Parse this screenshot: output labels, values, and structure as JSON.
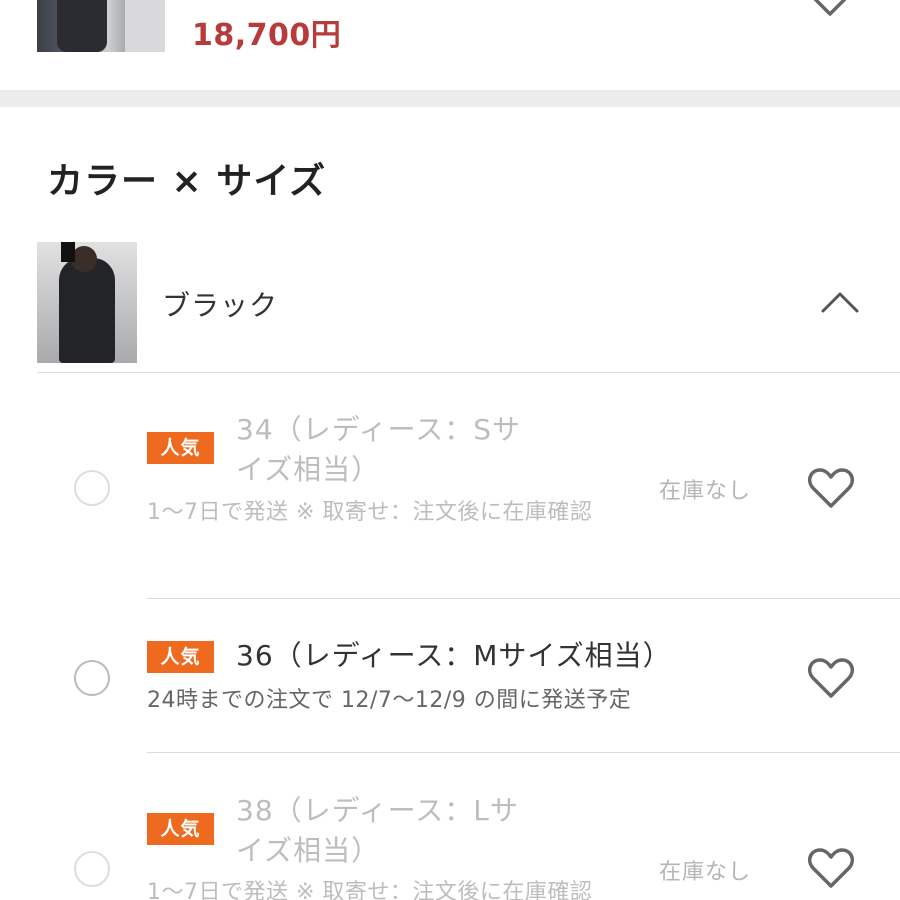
{
  "top_product": {
    "price": "18,700円",
    "thumbnail_icon": "product-photo",
    "wishlist_icon": "heart-outline-icon"
  },
  "section": {
    "title": "カラー × サイズ"
  },
  "color_group": {
    "name": "ブラック",
    "thumbnail_icon": "product-photo",
    "expanded": true,
    "toggle_icon": "chevron-up-icon"
  },
  "sizes": [
    {
      "badge": "人気",
      "label": "34（レディース：Sサイズ相当）",
      "shipping": "1～7日で発送 ※ 取寄せ：注文後に在庫確認",
      "stock": "在庫なし",
      "available": false
    },
    {
      "badge": "人気",
      "label": "36（レディース：Mサイズ相当）",
      "shipping": "24時までの注文で 12/7～12/9 の間に発送予定",
      "stock": "",
      "available": true
    },
    {
      "badge": "人気",
      "label": "38（レディース：Lサイズ相当）",
      "shipping": "1～7日で発送 ※ 取寄せ：注文後に在庫確認",
      "stock": "在庫なし",
      "available": false
    }
  ],
  "colors": {
    "price": "#b83a3a",
    "badge": "#ee6a1f",
    "muted_text": "#bdbdbd",
    "divider": "#ececec"
  }
}
